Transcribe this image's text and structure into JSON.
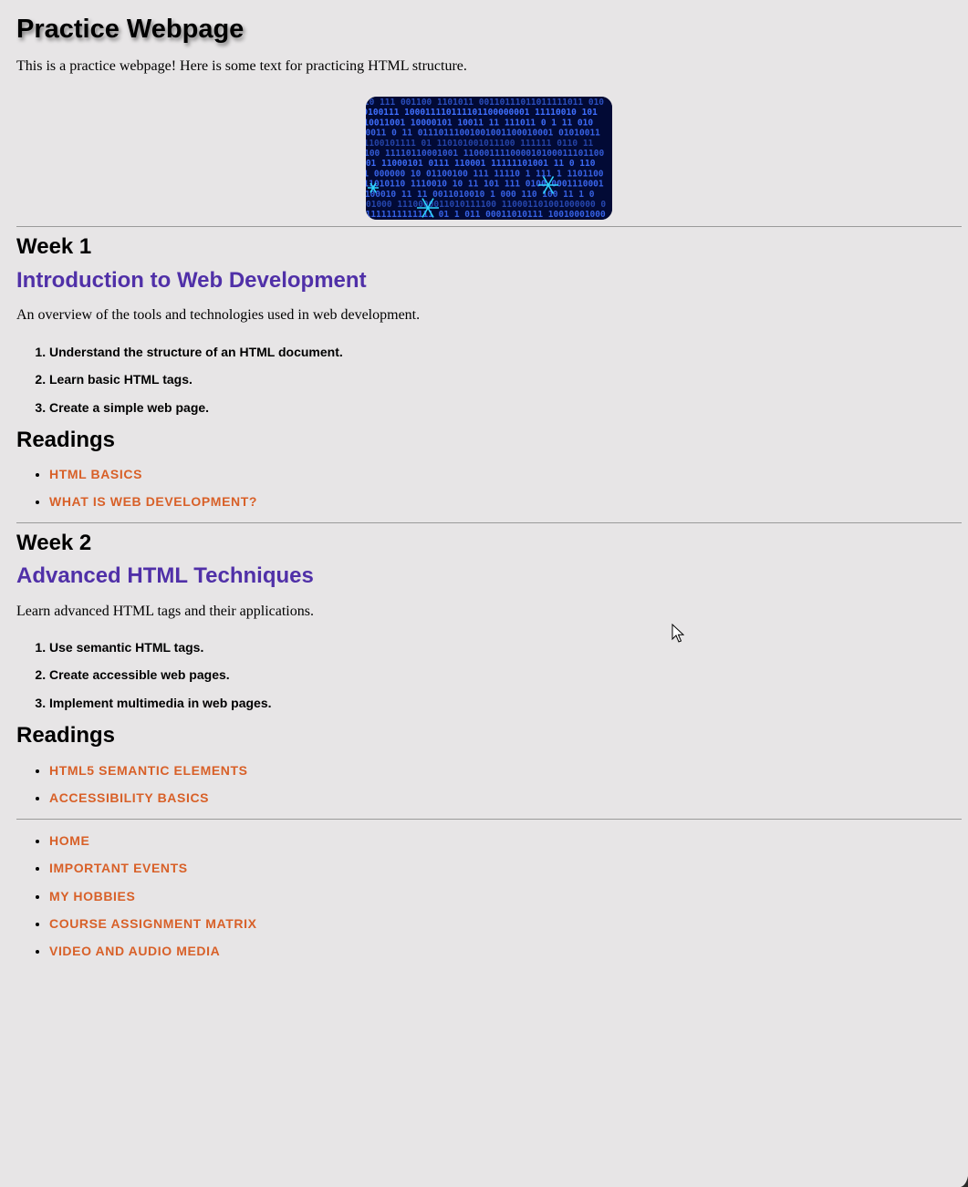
{
  "header": {
    "title": "Practice Webpage",
    "intro": "This is a practice webpage! Here is some text for practicing HTML structure."
  },
  "hero_image": {
    "icon": "binary-code-image",
    "colors": {
      "background": "#020a35",
      "digits": "#3f6fff",
      "accent": "#2fd5ff"
    }
  },
  "weeks": [
    {
      "label": "Week 1",
      "topic": "Introduction to Web Development",
      "description": "An overview of the tools and technologies used in web development.",
      "objectives": [
        "Understand the structure of an HTML document.",
        "Learn basic HTML tags.",
        "Create a simple web page."
      ],
      "readings_heading": "Readings",
      "readings": [
        "HTML Basics",
        "What is Web Development?"
      ]
    },
    {
      "label": "Week 2",
      "topic": "Advanced HTML Techniques",
      "description": "Learn advanced HTML tags and their applications.",
      "objectives": [
        "Use semantic HTML tags.",
        "Create accessible web pages.",
        "Implement multimedia in web pages."
      ],
      "readings_heading": "Readings",
      "readings": [
        "HTML5 Semantic Elements",
        "Accessibility Basics"
      ]
    }
  ],
  "footer_nav": {
    "items": [
      "Home",
      "Important Events",
      "My Hobbies",
      "Course Assignment Matrix",
      "Video and Audio Media"
    ]
  },
  "theme": {
    "page_background": "#e7e5e6",
    "topic_color": "#5030a8",
    "link_color": "#d86028",
    "rule_color": "#9a9a9a"
  }
}
